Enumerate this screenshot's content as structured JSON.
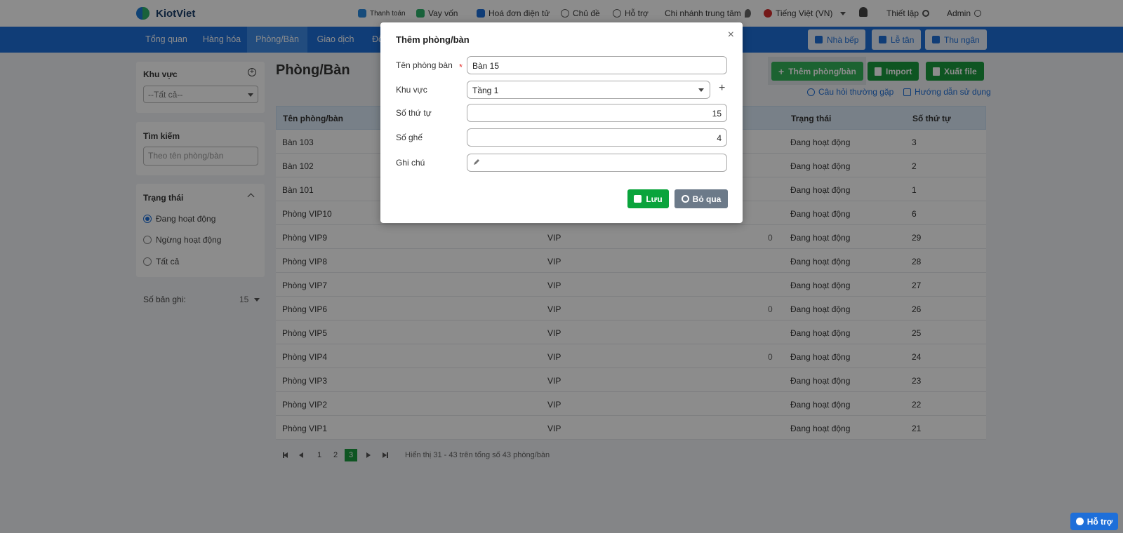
{
  "header": {
    "logo": "KiotViet",
    "payment": "Thanh toán",
    "loan": "Vay vốn",
    "einvoice": "Hoá đơn điện tử",
    "theme": "Chủ đề",
    "support": "Hỗ trợ",
    "branch": "Chi nhánh trung tâm",
    "language": "Tiếng Việt (VN)",
    "settings": "Thiết lập",
    "user": "Admin"
  },
  "nav": {
    "items": [
      "Tổng quan",
      "Hàng hóa",
      "Phòng/Bàn",
      "Giao dịch",
      "Đố"
    ],
    "kitchen": "Nhà bếp",
    "reception": "Lễ tân",
    "cashier": "Thu ngân"
  },
  "sidebar": {
    "area_title": "Khu vực",
    "area_select": "--Tất cả--",
    "search_title": "Tìm kiếm",
    "search_placeholder": "Theo tên phòng/bàn",
    "status_title": "Trạng thái",
    "status_options": [
      "Đang hoạt động",
      "Ngừng hoạt động",
      "Tất cả"
    ],
    "records_label": "Số bản ghi:",
    "records_value": "15"
  },
  "main": {
    "title": "Phòng/Bàn",
    "add_button": "Thêm phòng/bàn",
    "import_button": "Import",
    "export_button": "Xuất file",
    "faq_link": "Câu hỏi thường gặp",
    "guide_link": "Hướng dẫn sử dụng",
    "columns": [
      "Tên phòng/bàn",
      "Trạng thái",
      "Số thứ tự"
    ],
    "rows": [
      {
        "name": "Bàn 103",
        "area": "",
        "seats": "",
        "status": "Đang hoạt động",
        "order": "3"
      },
      {
        "name": "Bàn 102",
        "area": "",
        "seats": "",
        "status": "Đang hoạt động",
        "order": "2"
      },
      {
        "name": "Bàn 101",
        "area": "",
        "seats": "",
        "status": "Đang hoạt động",
        "order": "1"
      },
      {
        "name": "Phòng VIP10",
        "area": "",
        "seats": "",
        "status": "Đang hoạt động",
        "order": "6"
      },
      {
        "name": "Phòng VIP9",
        "area": "VIP",
        "seats": "0",
        "status": "Đang hoạt động",
        "order": "29"
      },
      {
        "name": "Phòng VIP8",
        "area": "VIP",
        "seats": "",
        "status": "Đang hoạt động",
        "order": "28"
      },
      {
        "name": "Phòng VIP7",
        "area": "VIP",
        "seats": "",
        "status": "Đang hoạt động",
        "order": "27"
      },
      {
        "name": "Phòng VIP6",
        "area": "VIP",
        "seats": "0",
        "status": "Đang hoạt động",
        "order": "26"
      },
      {
        "name": "Phòng VIP5",
        "area": "VIP",
        "seats": "",
        "status": "Đang hoạt động",
        "order": "25"
      },
      {
        "name": "Phòng VIP4",
        "area": "VIP",
        "seats": "0",
        "status": "Đang hoạt động",
        "order": "24"
      },
      {
        "name": "Phòng VIP3",
        "area": "VIP",
        "seats": "",
        "status": "Đang hoạt động",
        "order": "23"
      },
      {
        "name": "Phòng VIP2",
        "area": "VIP",
        "seats": "",
        "status": "Đang hoạt động",
        "order": "22"
      },
      {
        "name": "Phòng VIP1",
        "area": "VIP",
        "seats": "",
        "status": "Đang hoạt động",
        "order": "21"
      }
    ],
    "pages": [
      "1",
      "2",
      "3"
    ],
    "current_page": "3",
    "summary": "Hiển thị 31 - 43 trên tổng số 43 phòng/bàn"
  },
  "modal": {
    "title": "Thêm phòng/bàn",
    "close": "×",
    "name_label": "Tên phòng bàn",
    "required_mark": "*",
    "name_value": "Bàn 15",
    "area_label": "Khu vực",
    "area_value": "Tầng 1",
    "add_area": "+",
    "order_label": "Số thứ tự",
    "order_value": "15",
    "seats_label": "Số ghế",
    "seats_value": "4",
    "note_label": "Ghi chú",
    "note_value": "",
    "save_button": "Lưu",
    "cancel_button": "Bỏ qua"
  },
  "floating_help": "Hỗ trợ",
  "colors": {
    "primary": "#1e6fd9",
    "success": "#1a9c3f",
    "muted_button": "#6c7a89"
  }
}
